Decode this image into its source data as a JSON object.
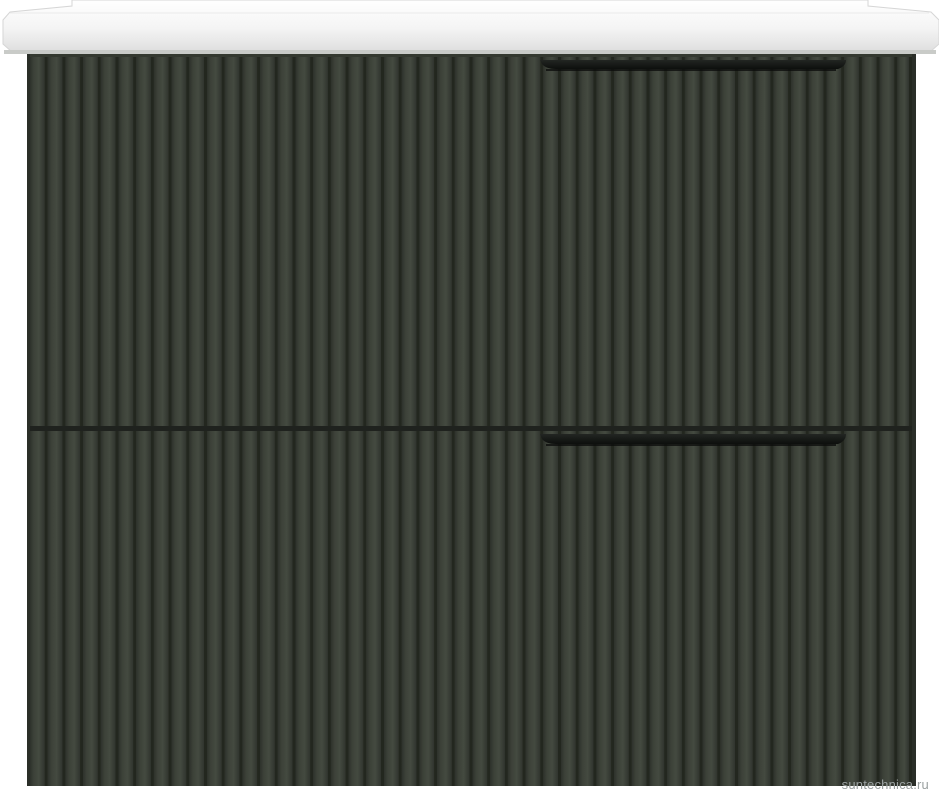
{
  "image": {
    "subject": "vanity-cabinet-with-basin",
    "colors": {
      "background": "#ffffff",
      "cabinet_body": "#3a3f36",
      "rib_highlight": "#454a40",
      "rib_shadow": "#2c302a",
      "basin": "#f7f7f7",
      "handle": "#151715"
    }
  },
  "watermark": {
    "text": "suntechnica.ru"
  }
}
